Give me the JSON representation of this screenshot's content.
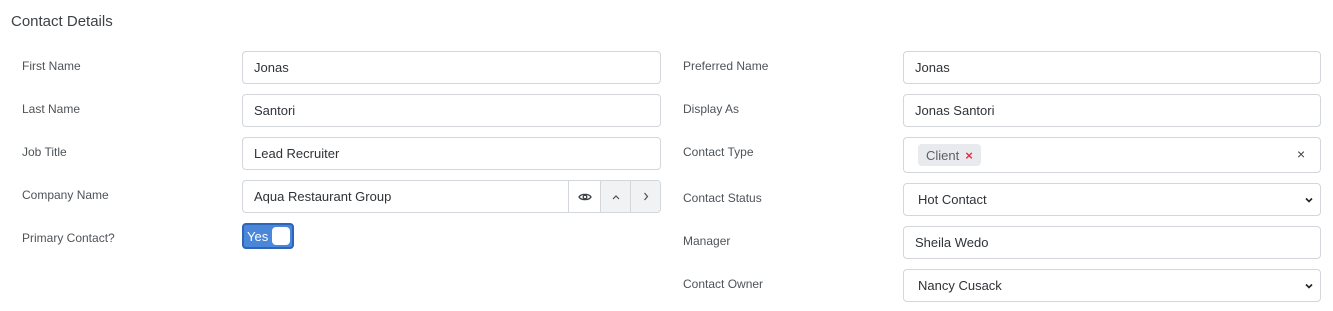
{
  "section": {
    "title": "Contact Details"
  },
  "left": {
    "first_name": {
      "label": "First Name",
      "value": "Jonas"
    },
    "last_name": {
      "label": "Last Name",
      "value": "Santori"
    },
    "job_title": {
      "label": "Job Title",
      "value": "Lead Recruiter"
    },
    "company_name": {
      "label": "Company Name",
      "value": "Aqua Restaurant Group"
    },
    "primary_contact": {
      "label": "Primary Contact?",
      "toggle_text": "Yes",
      "on": true
    }
  },
  "right": {
    "preferred_name": {
      "label": "Preferred Name",
      "value": "Jonas"
    },
    "display_as": {
      "label": "Display As",
      "value": "Jonas Santori"
    },
    "contact_type": {
      "label": "Contact Type",
      "tags": [
        "Client"
      ],
      "tag_remove": "×",
      "clear": "×"
    },
    "contact_status": {
      "label": "Contact Status",
      "value": "Hot Contact"
    },
    "manager": {
      "label": "Manager",
      "value": "Sheila Wedo"
    },
    "contact_owner": {
      "label": "Contact Owner",
      "value": "Nancy Cusack"
    }
  },
  "icons": {
    "eye": "eye-icon",
    "chevron_up": "chevron-up-icon",
    "chevron_right": "chevron-right-icon",
    "chevron_down": "chevron-down-icon"
  },
  "colors": {
    "toggle_on": "#4a86d9",
    "tag_remove": "#e0344b"
  }
}
